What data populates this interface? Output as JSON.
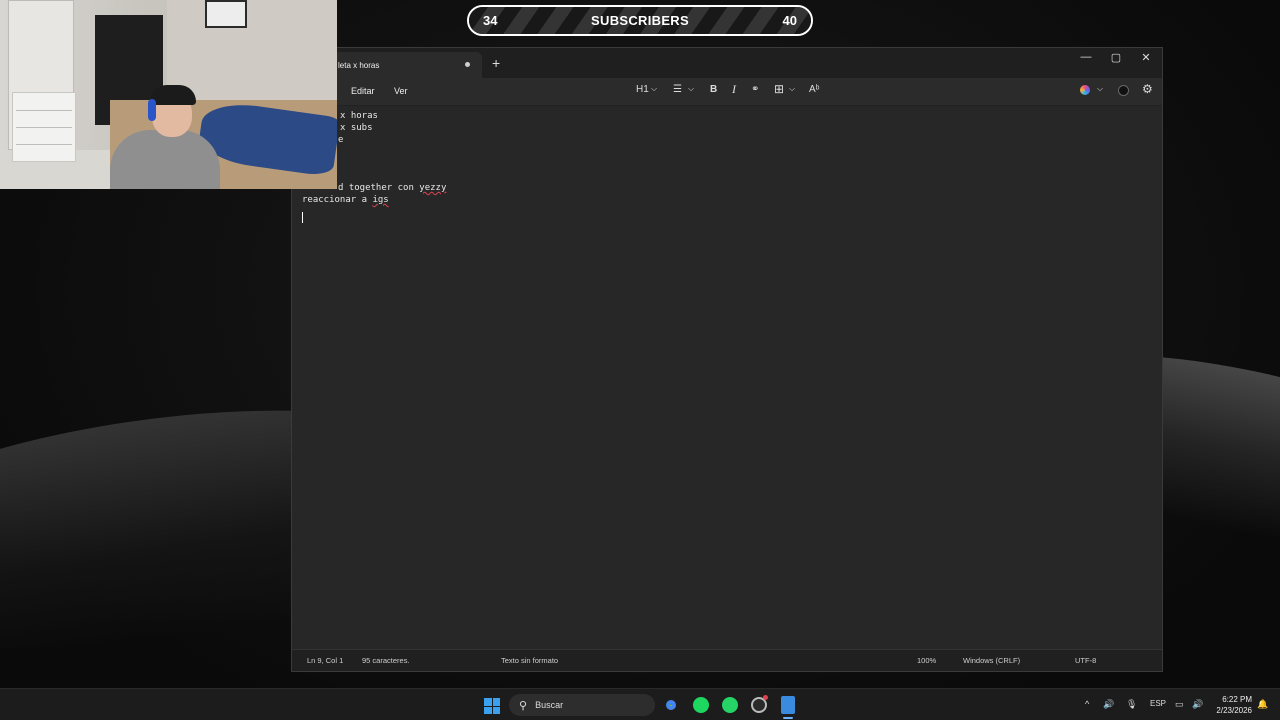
{
  "overlay": {
    "current": "34",
    "label": "SUBSCRIBERS",
    "goal": "40"
  },
  "window": {
    "tab_title": "leta x horas",
    "new_tab": "+",
    "controls": {
      "minimize": "—",
      "maximize": "▢",
      "close": "✕"
    }
  },
  "menu": {
    "edit": "Editar",
    "view": "Ver"
  },
  "toolbar": {
    "heading": "H1",
    "chevron": "⌵",
    "list": "☰",
    "bold": "B",
    "italic": "I",
    "link": "⚭",
    "table": "⊞",
    "spell": "Aᵇ"
  },
  "editor": {
    "lines": [
      "x horas",
      "x subs",
      "e",
      "d together con yezzy",
      "reaccionar a igs"
    ]
  },
  "status": {
    "position": "Ln 9, Col 1",
    "chars": "95 caracteres.",
    "format": "Texto sin formato",
    "zoom": "100%",
    "eol": "Windows (CRLF)",
    "encoding": "UTF-8"
  },
  "taskbar": {
    "search_placeholder": "Buscar",
    "search_glyph": "⚲",
    "lang": "ESP",
    "time": "6:22 PM",
    "date": "2/23/2026",
    "tray_chevron": "^",
    "volume": "🔊",
    "mic": "🎙",
    "bell": "🔔"
  },
  "colors": {
    "window_bg": "#272727",
    "accent": "#3aa0f0",
    "spell_error": "#e0424f"
  }
}
